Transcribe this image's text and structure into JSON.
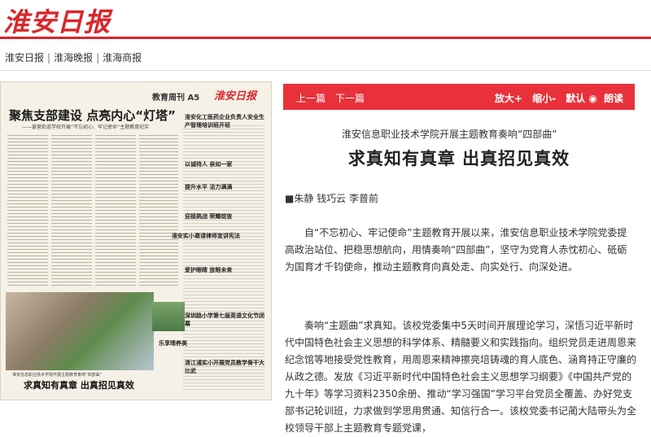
{
  "site": {
    "logo": "淮安日报"
  },
  "nav": {
    "items": [
      "淮安日报",
      "淮海晚报",
      "淮海商报"
    ],
    "separator": "|"
  },
  "paper": {
    "page_label": "教育周刊 A5",
    "logo": "淮安日报",
    "headline": "聚焦支部建设  点亮内心“灯塔”",
    "subheadline": "——姜营街道学校开展“不忘初心、牢记使命”主题教育纪实",
    "right_titles": [
      "淮安化工医药企业负责人安全生产管理培训班开班",
      "以诚待人  亲如一家",
      "提升水平  活力满满",
      "迎接挑战  荣耀绽放",
      "淮安实小邀请律师宣讲宪法",
      "爱护眼睛  放眼未来",
      "深圳路小学第七届英语文化节闭幕",
      "清江浦实小开展党员教学骨干大比武"
    ],
    "photo_caption": "乐享晴养美",
    "bottom_caption": "淮安信息职业技术学院开展主题教育奏响“四部曲”",
    "bottom_title": "求真知有真章  出真招见真效"
  },
  "toolbar": {
    "prev": "上一篇",
    "next": "下一篇",
    "zoom_in": "放大+",
    "zoom_out": "缩小-",
    "default": "默认",
    "read": "朗读"
  },
  "article": {
    "subtitle": "淮安信息职业技术学院开展主题教育奏响“四部曲”",
    "title": "求真知有真章  出真招见真效",
    "author": "■朱静 钱巧云 李普前",
    "paragraphs": [
      "自“不忘初心、牢记使命”主题教育开展以来，淮安信息职业技术学院党委提高政治站位、把稳思想航向，用情奏响“四部曲”，坚守为党育人赤忱初心、砥砺为国育才千钧使命，推动主题教育向真处走、向实处行、向深处进。",
      "奏响“主题曲”求真知。该校党委集中5天时间开展理论学习，深悟习近平新时代中国特色社会主义思想的科学体系、精髓要义和实践指向。组织党员走进周恩来纪念馆等地接受党性教育，用周恩来精神擦亮培铸魂的育人底色、涵育持正守廉的从政之德。发放《习近平新时代中国特色社会主义思想学习纲要》《中国共产党的九十年》等学习资料2350余册、推动“学习强国”学习平台党员全覆盖、办好党支部书记轮训班，力求做到学思用贯通、知信行合一。该校党委书记蔺大陆带头为全校领导干部上主题教育专题党课，"
    ]
  }
}
